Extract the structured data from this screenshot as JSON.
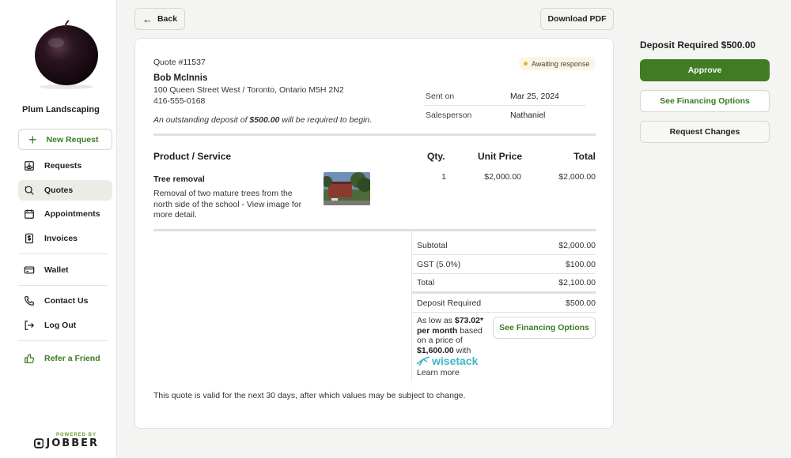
{
  "sidebar": {
    "company": "Plum Landscaping",
    "new_request": "New Request",
    "items": [
      {
        "label": "Requests",
        "icon": "inbox-download-icon"
      },
      {
        "label": "Quotes",
        "icon": "quote-search-icon",
        "active": true
      },
      {
        "label": "Appointments",
        "icon": "calendar-icon"
      },
      {
        "label": "Invoices",
        "icon": "invoice-dollar-icon"
      },
      {
        "label": "Wallet",
        "icon": "credit-card-icon"
      },
      {
        "label": "Contact Us",
        "icon": "phone-icon"
      },
      {
        "label": "Log Out",
        "icon": "logout-icon"
      },
      {
        "label": "Refer a Friend",
        "icon": "thumbs-up-icon"
      }
    ],
    "powered_by": "POWERED BY",
    "jobber": "JOBBER"
  },
  "toolbar": {
    "back": "Back",
    "download_pdf": "Download PDF"
  },
  "quote": {
    "number": "Quote #11537",
    "status": "Awaiting response",
    "client_name": "Bob McInnis",
    "address": "100 Queen Street West / Toronto, Ontario M5H 2N2",
    "phone": "416-555-0168",
    "deposit_note_prefix": "An outstanding deposit of ",
    "deposit_note_amount": "$500.00",
    "deposit_note_suffix": " will be required to begin.",
    "sent_on_label": "Sent on",
    "sent_on_value": "Mar 25, 2024",
    "salesperson_label": "Salesperson",
    "salesperson_value": "Nathaniel",
    "headers": {
      "product": "Product / Service",
      "qty": "Qty.",
      "unit_price": "Unit Price",
      "total": "Total"
    },
    "line_item": {
      "name": "Tree removal",
      "description": "Removal of two mature trees from the north side of the school - View image for more detail.",
      "qty": "1",
      "unit_price": "$2,000.00",
      "total": "$2,000.00"
    },
    "summary": {
      "subtotal_label": "Subtotal",
      "subtotal_value": "$2,000.00",
      "gst_label": "GST (5.0%)",
      "gst_value": "$100.00",
      "total_label": "Total",
      "total_value": "$2,100.00",
      "deposit_label": "Deposit Required",
      "deposit_value": "$500.00"
    },
    "financing": {
      "as_low_as": "As low as ",
      "monthly": "$73.02*",
      "per_month": "per month",
      "based_on": " based on a price of ",
      "price": "$1,600.00",
      "with": " with",
      "wisetack": "wisetack",
      "learn_more": "Learn more",
      "button": "See Financing Options"
    },
    "validity": "This quote is valid for the next 30 days, after which values may be subject to change."
  },
  "side_panel": {
    "deposit_title": "Deposit Required $500.00",
    "approve": "Approve",
    "financing": "See Financing Options",
    "request_changes": "Request Changes"
  },
  "colors": {
    "brand_green": "#3f7c23",
    "status_dot": "#e0b82b",
    "wisetack": "#3fb5c4"
  }
}
